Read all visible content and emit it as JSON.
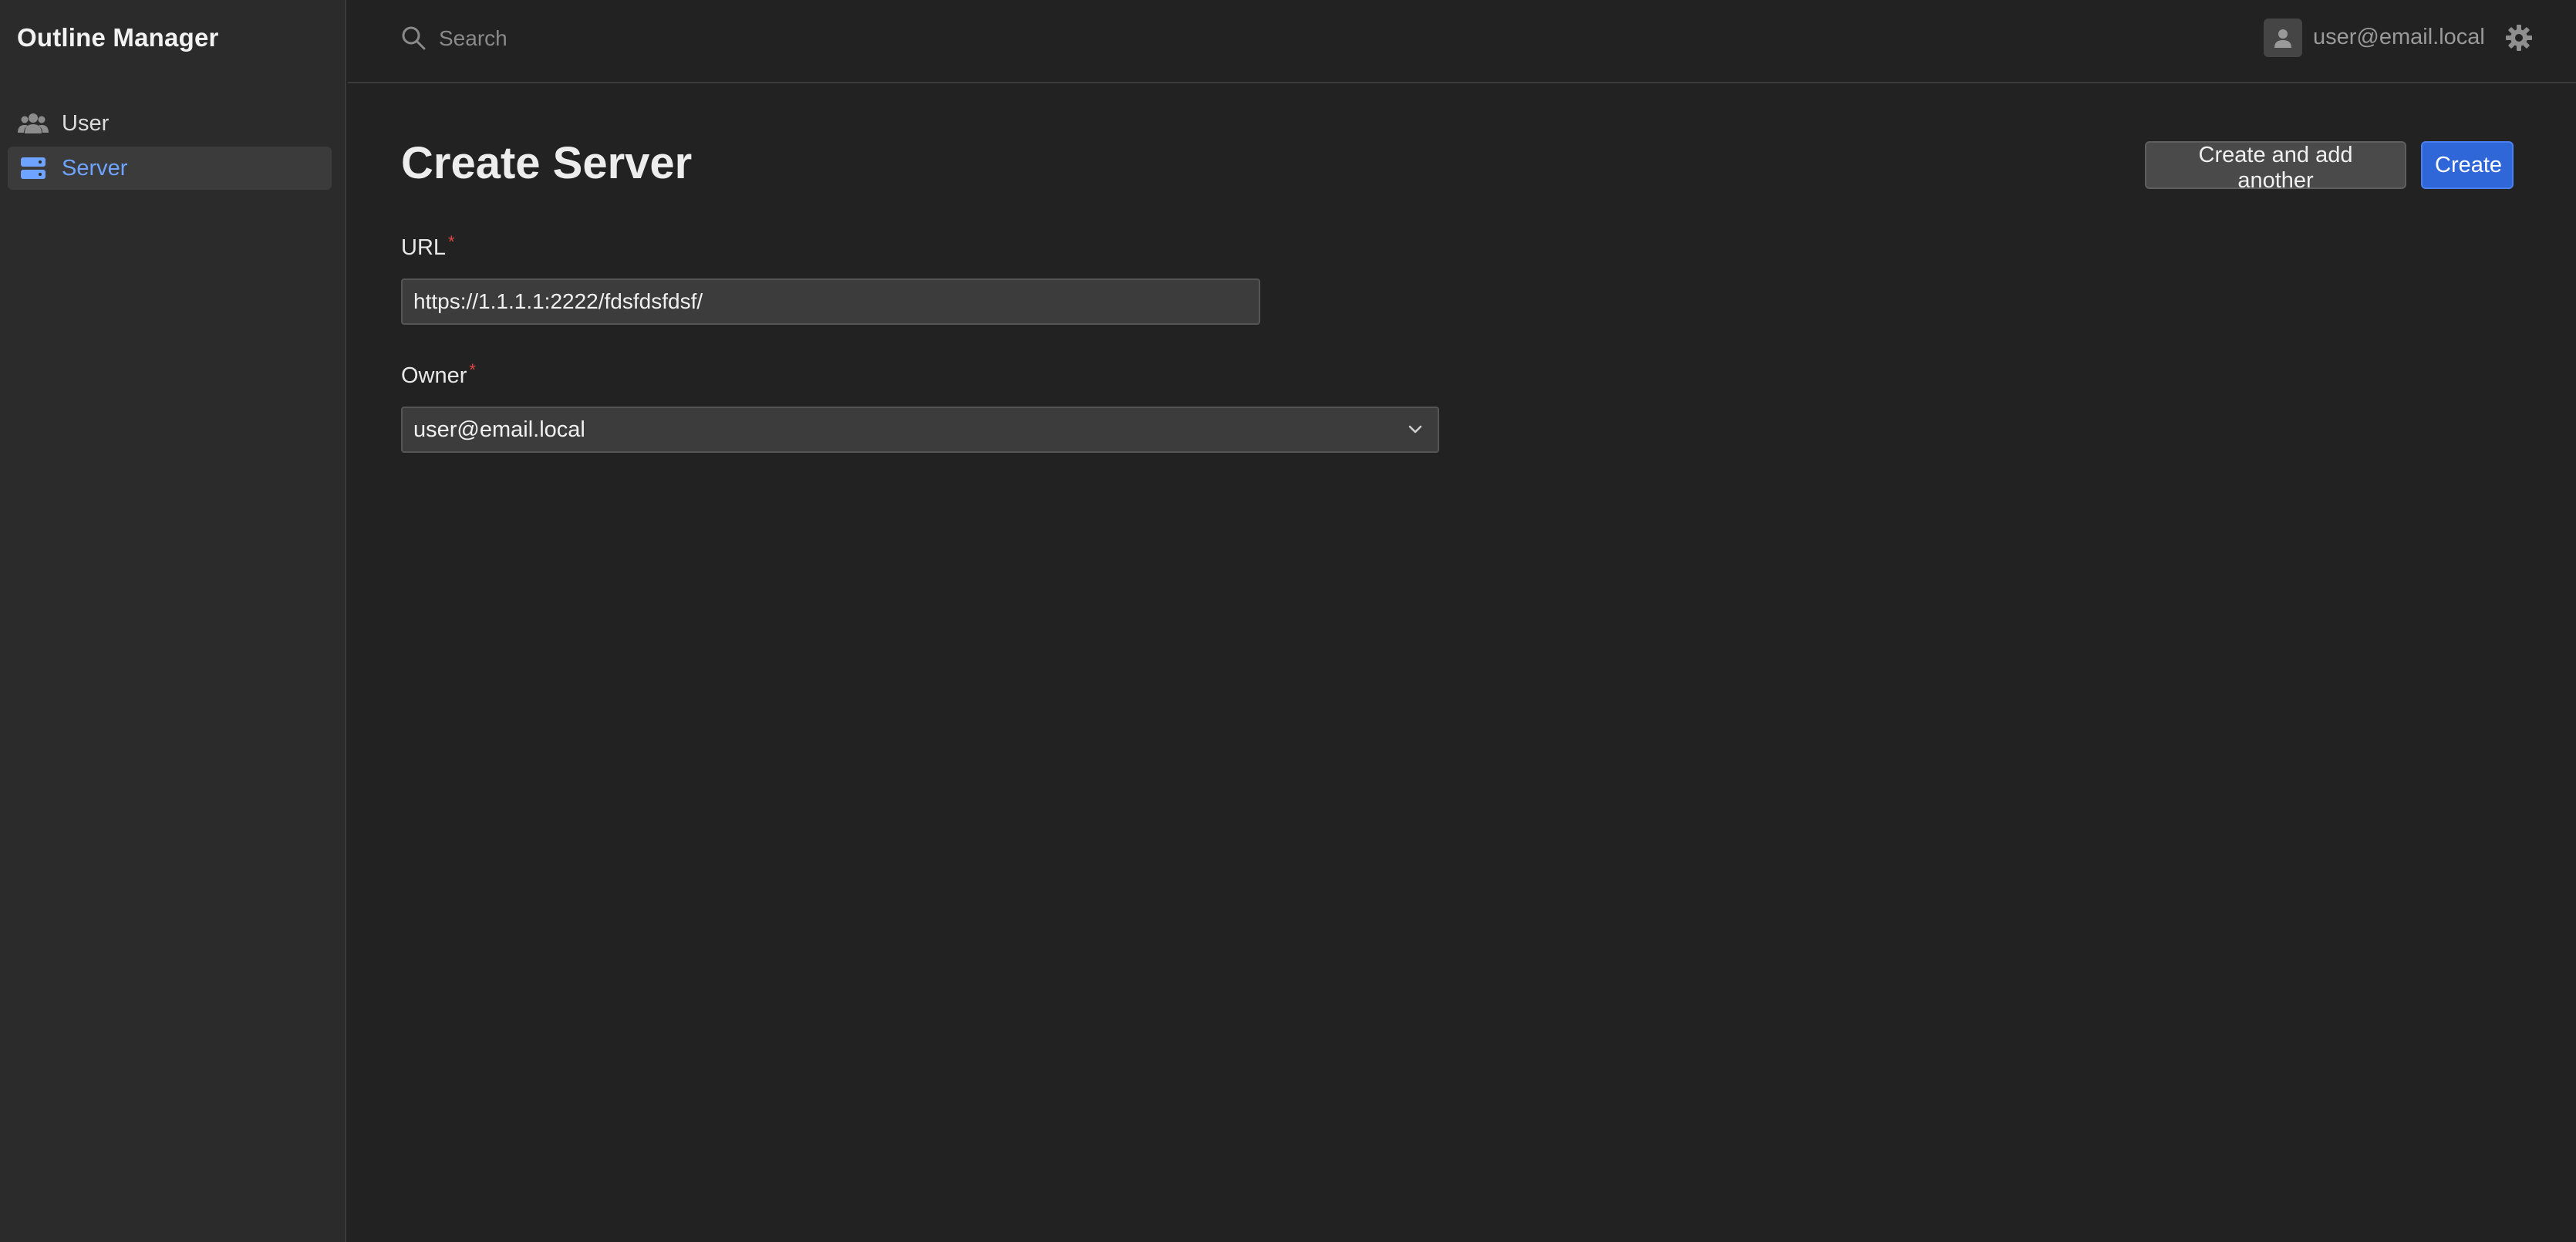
{
  "app": {
    "title": "Outline Manager"
  },
  "sidebar": {
    "items": [
      {
        "label": "User",
        "icon": "users-icon",
        "active": false
      },
      {
        "label": "Server",
        "icon": "server-icon",
        "active": true
      }
    ]
  },
  "topbar": {
    "search_placeholder": "Search",
    "user_email": "user@email.local",
    "icons": [
      "search-icon",
      "user-avatar-icon",
      "gear-icon"
    ]
  },
  "main": {
    "page_title": "Create Server",
    "buttons": {
      "create_and_add_another": "Create and add another",
      "create": "Create"
    },
    "form": {
      "url_label": "URL",
      "url_required": "*",
      "url_value": "https://1.1.1.1:2222/fdsfdsfdsf/",
      "owner_label": "Owner",
      "owner_required": "*",
      "owner_value": "user@email.local"
    }
  },
  "colors": {
    "background": "#222222",
    "sidebar": "#2b2b2b",
    "accent": "#2f66d8",
    "active_nav_text": "#6ea4ff",
    "required": "#e04646"
  }
}
